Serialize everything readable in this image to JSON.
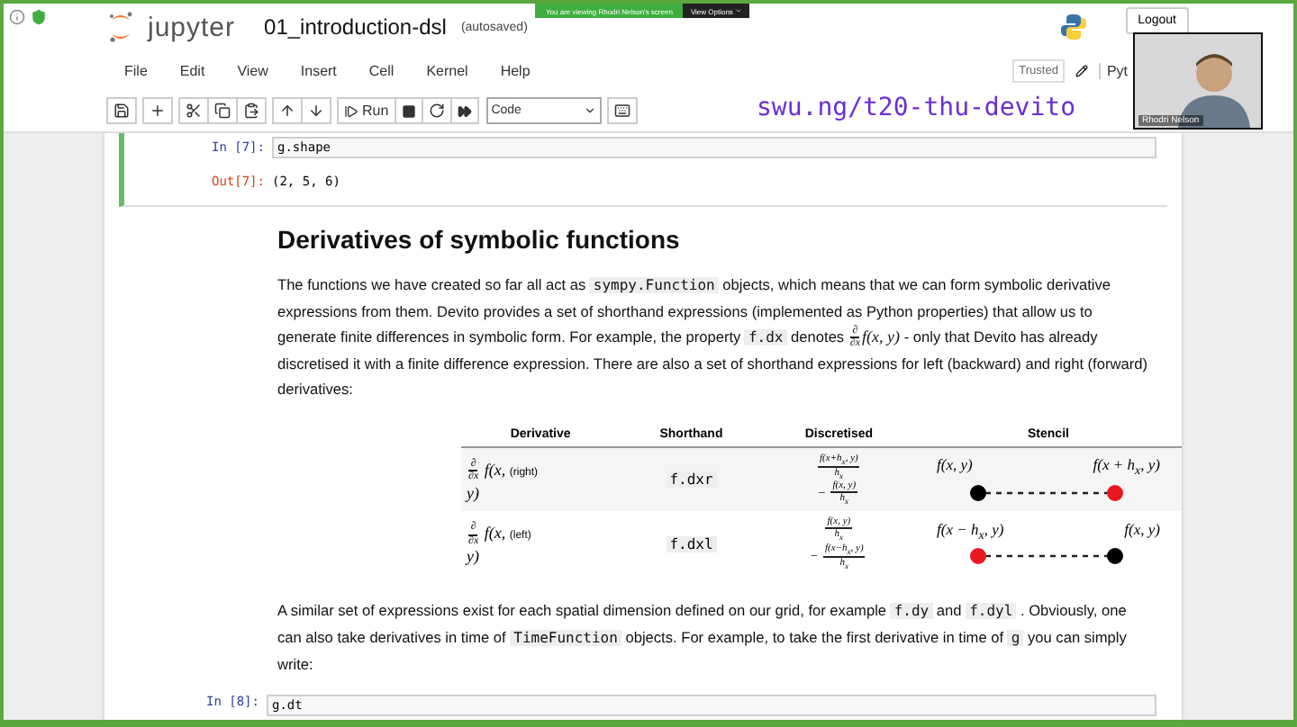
{
  "share_banner": {
    "text": "You are viewing Rhodri Nelson's screen",
    "options": "View Options"
  },
  "header": {
    "brand": "jupyter",
    "notebook_title": "01_introduction-dsl",
    "save_status": "(autosaved)",
    "logout": "Logout"
  },
  "menu": [
    "File",
    "Edit",
    "View",
    "Insert",
    "Cell",
    "Kernel",
    "Help"
  ],
  "menu_right": {
    "trusted": "Trusted",
    "kernel": "Pyt"
  },
  "toolbar": {
    "run_label": "Run",
    "cell_type": "Code"
  },
  "overlay_link": "swu.ng/t20-thu-devito",
  "video_tile": {
    "name": "Rhodri Nelson"
  },
  "cells": [
    {
      "prompt": "In [7]:",
      "code": "g.shape",
      "output_prompt": "Out[7]:",
      "output": "(2, 5, 6)"
    }
  ],
  "markdown": {
    "heading": "Derivatives of symbolic functions",
    "paragraph_1": [
      {
        "kind": "text",
        "text": "The functions we have created so far all act as "
      },
      {
        "kind": "code",
        "text": "sympy.Function"
      },
      {
        "kind": "text",
        "text": " objects, which means that we can form symbolic derivative expressions from them. Devito provides a set of shorthand expressions (implemented as Python properties) that allow us to generate finite differences in symbolic form. For example, the property "
      },
      {
        "kind": "code",
        "text": "f.dx"
      },
      {
        "kind": "text",
        "text": " denotes "
      },
      {
        "kind": "frac",
        "num": "∂",
        "den": "∂x"
      },
      {
        "kind": "math",
        "text": "f(x, y)"
      },
      {
        "kind": "text",
        "text": " - only that Devito has already discretised it with a finite difference expression. There are also a set of shorthand expressions for left (backward) and right (forward) derivatives:"
      }
    ],
    "table": {
      "columns": [
        "Derivative",
        "Shorthand",
        "Discretised",
        "Stencil"
      ],
      "rows": [
        {
          "derivative": {
            "num": "∂",
            "den": "∂x",
            "expr": "f(x,",
            "note": "(right)",
            "tail": "y)"
          },
          "shorthand": "f.dxr",
          "discretised": [
            {
              "num": "f(x+h$_{x}$, y)",
              "den": "h$_{x}$"
            },
            {
              "sign": "−",
              "num": "f(x, y)",
              "den": "h$_{x}$"
            }
          ],
          "stencil": [
            {
              "label": "f(x, y)",
              "color": "#000000"
            },
            {
              "label": "f(x + h$_{x}$, y)",
              "color": "#e8191f"
            }
          ]
        },
        {
          "derivative": {
            "num": "∂",
            "den": "∂x",
            "expr": "f(x,",
            "note": "(left)",
            "tail": "y)"
          },
          "shorthand": "f.dxl",
          "discretised": [
            {
              "num": "f(x, y)",
              "den": "h$_{x}$"
            },
            {
              "sign": "−",
              "num": "f(x−h$_{x}$, y)",
              "den": "h$_{x}$"
            }
          ],
          "stencil": [
            {
              "label": "f(x − h$_{x}$, y)",
              "color": "#e8191f"
            },
            {
              "label": "f(x, y)",
              "color": "#000000"
            }
          ]
        }
      ]
    },
    "paragraph_2": [
      {
        "kind": "text",
        "text": "A similar set of expressions exist for each spatial dimension defined on our grid, for example "
      },
      {
        "kind": "code",
        "text": "f.dy"
      },
      {
        "kind": "text",
        "text": " and "
      },
      {
        "kind": "code",
        "text": "f.dyl"
      },
      {
        "kind": "text",
        "text": " . Obviously, one can also take derivatives in time of "
      },
      {
        "kind": "code",
        "text": "TimeFunction"
      },
      {
        "kind": "text",
        "text": " objects. For example, to take the first derivative in time of "
      },
      {
        "kind": "code",
        "text": "g"
      },
      {
        "kind": "text",
        "text": " you can simply write:"
      }
    ]
  },
  "next_cell": {
    "prompt": "In [8]:",
    "code": "g.dt"
  }
}
